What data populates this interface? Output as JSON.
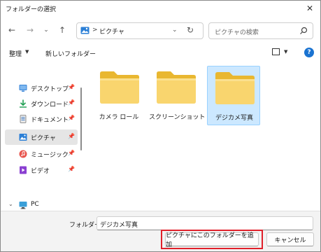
{
  "window": {
    "title": "フォルダーの選択"
  },
  "nav": {
    "back_icon": "arrow-left-icon",
    "forward_icon": "arrow-right-icon",
    "recent_icon": "chevron-down-icon",
    "up_icon": "arrow-up-icon",
    "address": {
      "separator": ">",
      "path": "ピクチャ",
      "icon": "pictures-icon"
    },
    "search": {
      "placeholder": "ピクチャの検索"
    }
  },
  "commands": {
    "organize": "整理",
    "new_folder": "新しいフォルダー",
    "view_icon": "view-icon",
    "help_icon": "help-icon",
    "help_glyph": "?"
  },
  "sidebar": {
    "items": [
      {
        "label": "デスクトップ",
        "icon": "desktop-icon",
        "pinned": true
      },
      {
        "label": "ダウンロード",
        "icon": "download-icon",
        "pinned": true
      },
      {
        "label": "ドキュメント",
        "icon": "documents-icon",
        "pinned": true
      },
      {
        "label": "ピクチャ",
        "icon": "pictures-icon",
        "pinned": true,
        "selected": true
      },
      {
        "label": "ミュージック",
        "icon": "music-icon",
        "pinned": true
      },
      {
        "label": "ビデオ",
        "icon": "video-icon",
        "pinned": true
      }
    ],
    "pc": {
      "label": "PC",
      "icon": "pc-icon"
    }
  },
  "content": {
    "folders": [
      {
        "label": "カメラ ロール",
        "selected": false
      },
      {
        "label": "スクリーンショット",
        "selected": false
      },
      {
        "label": "デジカメ写真",
        "selected": true
      }
    ]
  },
  "bottom": {
    "folder_label": "フォルダー:",
    "folder_value": "デジカメ写真",
    "select_button": "ピクチャにこのフォルダーを追加",
    "cancel_button": "キャンセル"
  },
  "colors": {
    "highlight": "#e0202a",
    "selection": "#cce8ff",
    "folder": "#f9d56e",
    "accent": "#1a73d1"
  }
}
